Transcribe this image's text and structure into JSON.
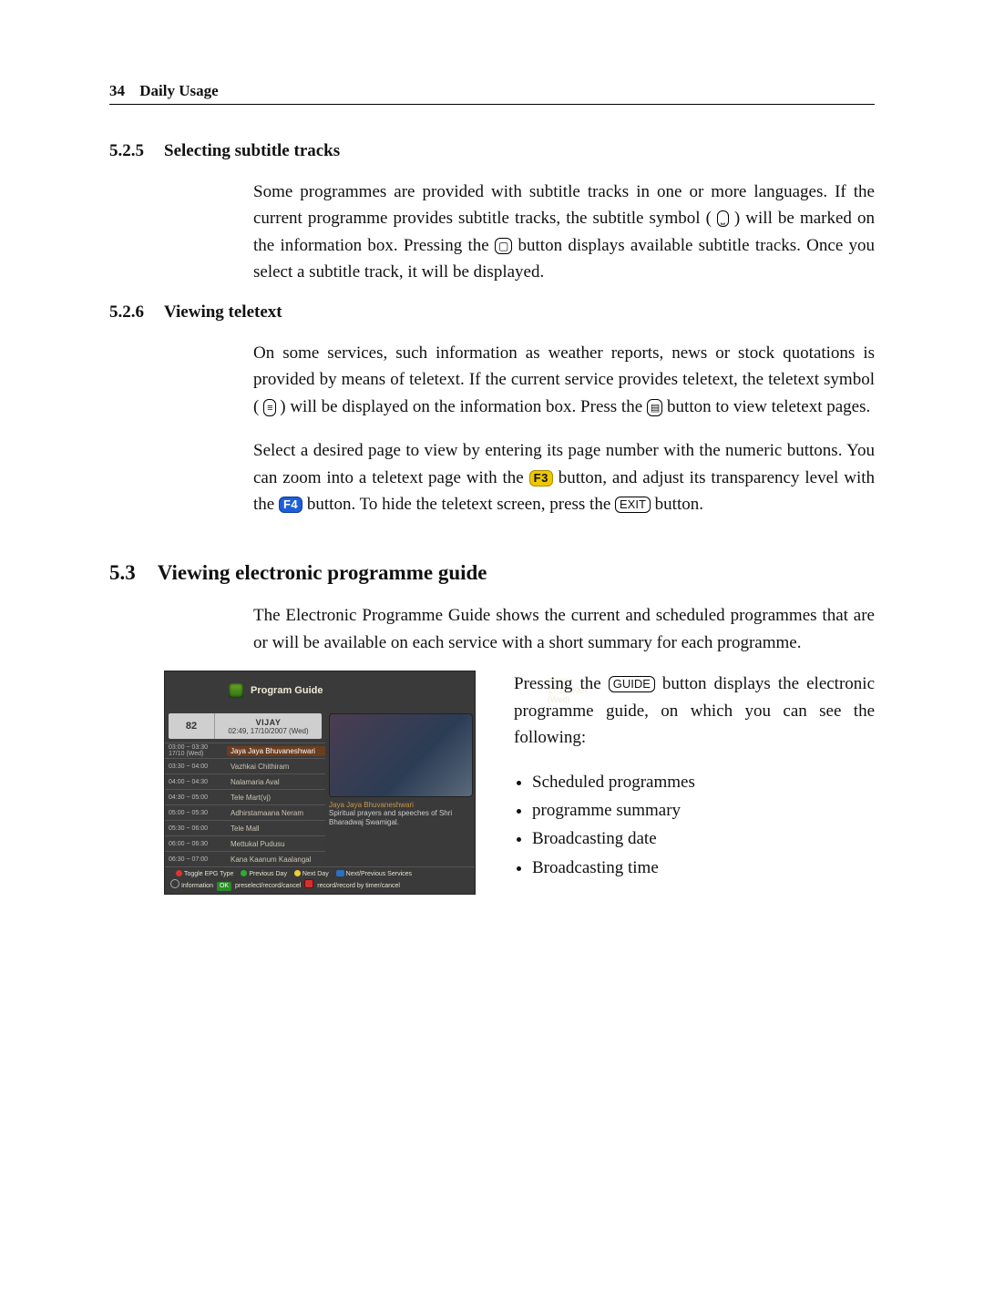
{
  "page": {
    "number": "34",
    "chapter": "Daily Usage"
  },
  "s525": {
    "num": "5.2.5",
    "title": "Selecting subtitle tracks",
    "para_a": "Some programmes are provided with subtitle tracks in one or more languages. If the current programme provides subtitle tracks, the subtitle symbol (",
    "para_b": ") will be marked on the information box. Pressing the ",
    "para_c": " button displays available subtitle tracks. Once you select a subtitle track, it will be displayed.",
    "btn_subtitle": "◑"
  },
  "s526": {
    "num": "5.2.6",
    "title": "Viewing teletext",
    "p1_a": "On some services, such information as weather reports, news or stock quotations is provided by means of teletext. If the current service provides teletext, the teletext symbol (",
    "p1_b": ") will be displayed on the information box. Press the ",
    "p1_c": " button to view teletext pages.",
    "p2_a": "Select a desired page to view by entering its page number with the numeric buttons. You can zoom into a teletext page with the ",
    "p2_b": " button, and adjust its transparency level with the ",
    "p2_c": " button. To hide the teletext screen, press the ",
    "p2_d": " button.",
    "btn_ttx": "▤",
    "btn_f3": "F3",
    "btn_f4": "F4",
    "btn_exit": "EXIT"
  },
  "s53": {
    "num": "5.3",
    "title": "Viewing electronic programme guide",
    "intro": "The Electronic Programme Guide shows the current and scheduled programmes that are or will be available on each service with a short summary for each programme.",
    "right_a": "Pressing the ",
    "right_b": " button displays the electronic programme guide, on which you can see the following:",
    "btn_guide": "GUIDE",
    "bullets": [
      "Scheduled programmes",
      "programme summary",
      "Broadcasting date",
      "Broadcasting time"
    ]
  },
  "epg": {
    "title": "Program Guide",
    "clock": "03:02, 17/10/2007 (Wed)",
    "ch_num": "82",
    "ch_name": "VIJAY",
    "ch_time": "02:49, 17/10/2007 (Wed)",
    "rows": [
      {
        "time": "03:00 ~ 03:30 17/10 (Wed)",
        "prog": "Jaya Jaya Bhuvaneshwari",
        "selected": true
      },
      {
        "time": "03:30 ~ 04:00",
        "prog": "Vazhkai Chithiram"
      },
      {
        "time": "04:00 ~ 04:30",
        "prog": "Nalamaria Aval"
      },
      {
        "time": "04:30 ~ 05:00",
        "prog": "Tele Mart(vj)"
      },
      {
        "time": "05:00 ~ 05:30",
        "prog": "Adhirstamaana Neram"
      },
      {
        "time": "05:30 ~ 06:00",
        "prog": "Tele Mall"
      },
      {
        "time": "06:00 ~ 06:30",
        "prog": "Mettukal Pudusu"
      },
      {
        "time": "06:30 ~ 07:00",
        "prog": "Kana Kaanum Kaalangal"
      }
    ],
    "desc_title": "Jaya Jaya Bhuvaneshwari",
    "desc": "Spiritual prayers and speeches of Shri Bharadwaj Swamigal.",
    "foot1_a": "Toggle EPG Type",
    "foot1_b": "Previous Day",
    "foot1_c": "Next Day",
    "foot1_d": "Next/Previous Services",
    "foot2_a": "Information",
    "foot2_b": "OK",
    "foot2_c": "preselect/record/cancel",
    "foot2_d": "record/record by timer/cancel"
  }
}
